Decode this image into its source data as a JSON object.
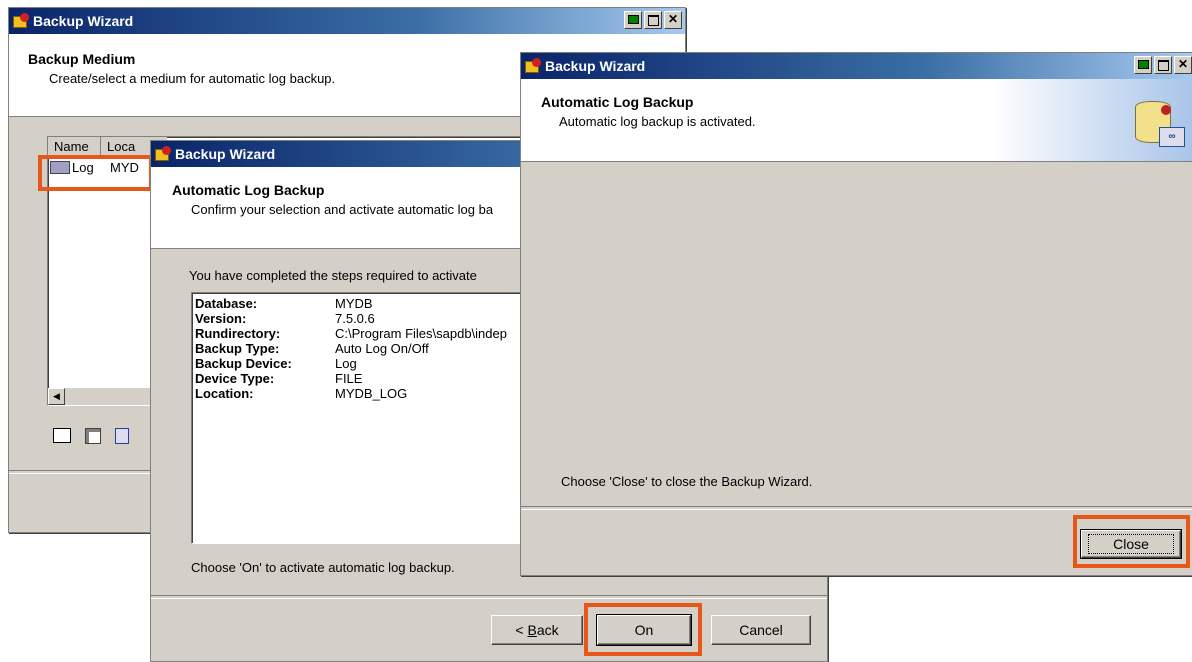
{
  "win1": {
    "title": "Backup Wizard",
    "header_title": "Backup Medium",
    "header_subtitle": "Create/select a medium for automatic log backup.",
    "columns": [
      "Name",
      "Loca"
    ],
    "row": {
      "name": "Log",
      "location": "MYD"
    }
  },
  "win2": {
    "title": "Backup Wizard",
    "header_title": "Automatic Log Backup",
    "header_subtitle": "Confirm your selection and activate automatic log ba",
    "intro": "You have completed the steps required to activate",
    "details": [
      {
        "key": "Database:",
        "value": "MYDB"
      },
      {
        "key": "Version:",
        "value": "7.5.0.6"
      },
      {
        "key": "Rundirectory:",
        "value": "C:\\Program Files\\sapdb\\indep"
      },
      {
        "key": "Backup Type:",
        "value": "Auto Log On/Off"
      },
      {
        "key": "Backup Device:",
        "value": "Log"
      },
      {
        "key": "Device Type:",
        "value": "FILE"
      },
      {
        "key": "Location:",
        "value": "MYDB_LOG"
      }
    ],
    "footer_text": "Choose 'On' to activate automatic log backup.",
    "back_prefix": "< ",
    "back_underlined": "B",
    "back_rest": "ack",
    "on_label": "On",
    "cancel_label": "Cancel"
  },
  "win3": {
    "title": "Backup Wizard",
    "header_title": "Automatic Log Backup",
    "header_subtitle": "Automatic log backup is activated.",
    "footer_text": "Choose 'Close' to close the Backup Wizard.",
    "close_label": "Close"
  },
  "highlight_color": "#e8571a",
  "titlebar_color": "#0a246a"
}
